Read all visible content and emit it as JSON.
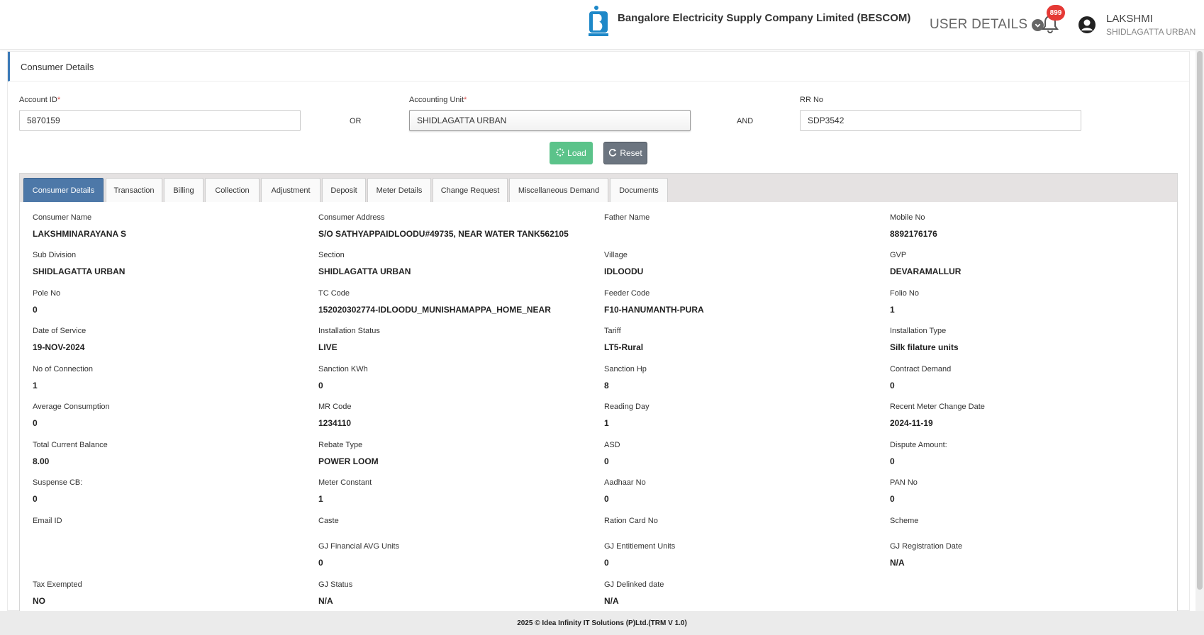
{
  "header": {
    "company": "Bangalore Electricity Supply Company Limited (BESCOM)",
    "user_details_label": "USER DETAILS",
    "notification_count": "899",
    "user_name": "LAKSHMI",
    "user_unit": "SHIDLAGATTA URBAN"
  },
  "panel": {
    "title": "Consumer Details"
  },
  "search": {
    "account_label": "Account ID",
    "account_value": "5870159",
    "or_label": "OR",
    "au_label": "Accounting Unit",
    "au_value": "SHIDLAGATTA URBAN",
    "and_label": "AND",
    "rr_label": "RR No",
    "rr_value": "SDP3542",
    "required_mark": "*",
    "load_label": "Load",
    "reset_label": "Reset"
  },
  "tabs": [
    "Consumer Details",
    "Transaction",
    "Billing",
    "Collection",
    "Adjustment",
    "Deposit",
    "Meter Details",
    "Change Request",
    "Miscellaneous Demand",
    "Documents"
  ],
  "fields": [
    [
      "Consumer Name",
      "LAKSHMINARAYANA S"
    ],
    [
      "Consumer Address",
      "S/O SATHYAPPAIDLOODU#49735, NEAR WATER TANK562105"
    ],
    [
      "Father Name",
      ""
    ],
    [
      "Mobile No",
      "8892176176"
    ],
    [
      "Sub Division",
      "SHIDLAGATTA URBAN"
    ],
    [
      "Section",
      "SHIDLAGATTA URBAN"
    ],
    [
      "Village",
      "IDLOODU"
    ],
    [
      "GVP",
      "DEVARAMALLUR"
    ],
    [
      "Pole No",
      "0"
    ],
    [
      "TC Code",
      "152020302774-IDLOODU_MUNISHAMAPPA_HOME_NEAR"
    ],
    [
      "Feeder Code",
      "F10-HANUMANTH-PURA"
    ],
    [
      "Folio No",
      "1"
    ],
    [
      "Date of Service",
      "19-NOV-2024"
    ],
    [
      "Installation Status",
      "LIVE"
    ],
    [
      "Tariff",
      "LT5-Rural"
    ],
    [
      "Installation Type",
      "Silk filature units"
    ],
    [
      "No of Connection",
      "1"
    ],
    [
      "Sanction KWh",
      "0"
    ],
    [
      "Sanction Hp",
      "8"
    ],
    [
      "Contract Demand",
      "0"
    ],
    [
      "Average Consumption",
      "0"
    ],
    [
      "MR Code",
      "1234110"
    ],
    [
      "Reading Day",
      "1"
    ],
    [
      "Recent Meter Change Date",
      "2024-11-19"
    ],
    [
      "Total Current Balance",
      "8.00"
    ],
    [
      "Rebate Type",
      "POWER LOOM"
    ],
    [
      "ASD",
      "0"
    ],
    [
      "Dispute Amount:",
      "0"
    ],
    [
      "Suspense CB:",
      "0"
    ],
    [
      "Meter Constant",
      "1"
    ],
    [
      "Aadhaar No",
      "0"
    ],
    [
      "PAN No",
      "0"
    ],
    [
      "Email ID",
      ""
    ],
    [
      "Caste",
      ""
    ],
    [
      "Ration Card No",
      ""
    ],
    [
      "Scheme",
      ""
    ],
    [
      "",
      ""
    ],
    [
      "GJ Financial AVG Units",
      "0"
    ],
    [
      "GJ Entitiement Units",
      "0"
    ],
    [
      "GJ Registration Date",
      "N/A"
    ],
    [
      "Tax Exempted",
      "NO"
    ],
    [
      "GJ Status",
      "N/A"
    ],
    [
      "GJ Delinked date",
      "N/A"
    ],
    [
      "",
      ""
    ]
  ],
  "footer": {
    "text": "2025 © Idea Infinity IT Solutions (P)Ltd.(TRM V 1.0)"
  },
  "colors": {
    "accent": "#4d78a8",
    "load_button": "#5bc38a",
    "reset_button": "#6c7580",
    "badge": "#e53935"
  }
}
